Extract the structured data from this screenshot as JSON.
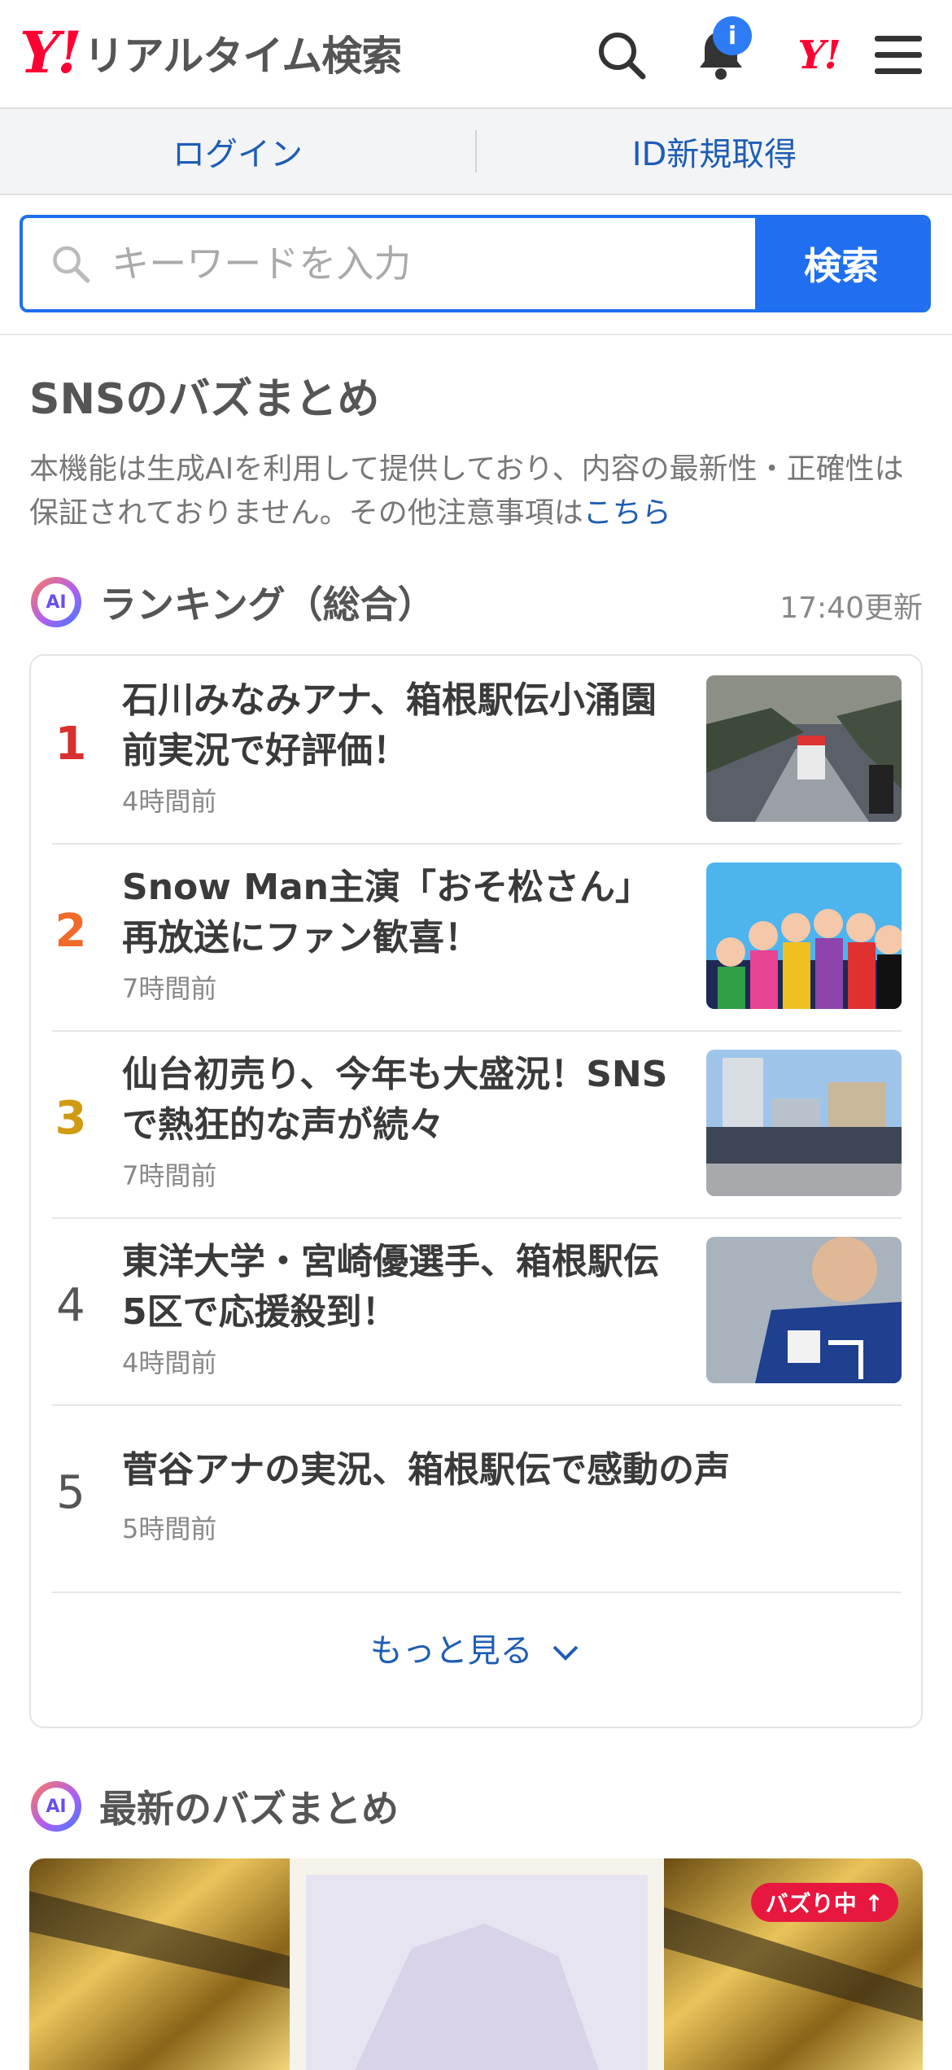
{
  "header": {
    "logo_mark": "Y!",
    "logo_text": "リアルタイム検索",
    "notification_badge": "i",
    "yahoo_mark": "Y!"
  },
  "auth": {
    "login": "ログイン",
    "signup": "ID新規取得"
  },
  "search": {
    "placeholder": "キーワードを入力",
    "button": "検索"
  },
  "section": {
    "title": "SNSのバズまとめ",
    "notice": "本機能は生成AIを利用して提供しており、内容の最新性・正確性は保証されておりません。その他注意事項は",
    "notice_link": "こちら"
  },
  "ranking": {
    "ai_label": "AI",
    "title": "ランキング（総合）",
    "updated": "17:40更新",
    "items": [
      {
        "rank": "1",
        "title": "石川みなみアナ、箱根駅伝小涌園前実況で好評価！",
        "time": "4時間前",
        "rank_color": "#d8302f"
      },
      {
        "rank": "2",
        "title": "Snow Man主演「おそ松さん」再放送にファン歓喜！",
        "time": "7時間前",
        "rank_color": "#f06a2a"
      },
      {
        "rank": "3",
        "title": "仙台初売り、今年も大盛況！SNSで熱狂的な声が続々",
        "time": "7時間前",
        "rank_color": "#d09a12"
      },
      {
        "rank": "4",
        "title": "東洋大学・宮崎優選手、箱根駅伝5区で応援殺到！",
        "time": "4時間前",
        "rank_color": "#555555"
      },
      {
        "rank": "5",
        "title": "菅谷アナの実況、箱根駅伝で感動の声",
        "time": "5時間前",
        "rank_color": "#555555"
      }
    ],
    "more": "もっと見る"
  },
  "latest": {
    "ai_label": "AI",
    "title": "最新のバズまとめ",
    "badge": "バズり中"
  }
}
